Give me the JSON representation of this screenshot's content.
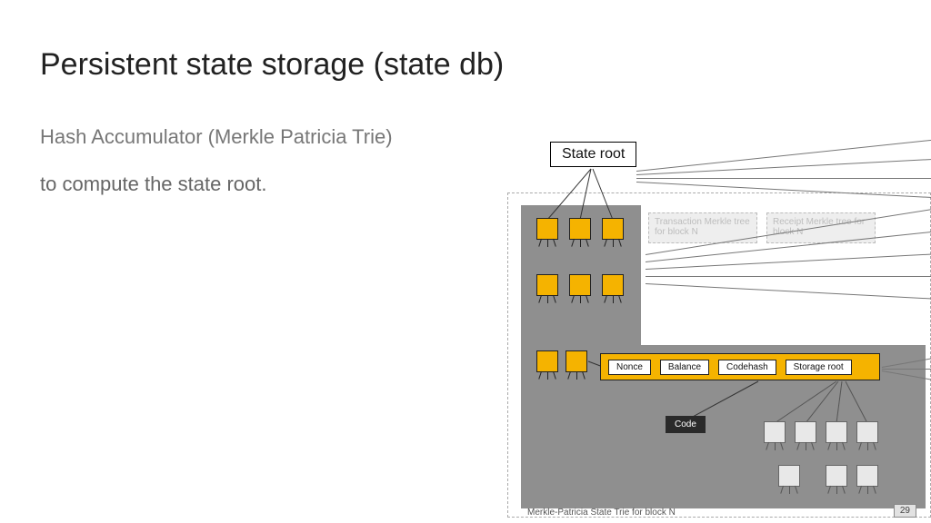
{
  "slide": {
    "title": "Persistent state storage (state db)",
    "subtitle1": "Hash Accumulator (Merkle Patricia Trie)",
    "subtitle2": "to compute the state root.",
    "page_number": "29"
  },
  "diagram": {
    "state_root_label": "State root",
    "faint_box_1": "Transaction Merkle tree for block N",
    "faint_box_2": "Receipt Merkle tree for block N",
    "account_fields": {
      "nonce": "Nonce",
      "balance": "Balance",
      "codehash": "Codehash",
      "storage_root": "Storage root"
    },
    "code_label": "Code",
    "caption": "Merkle-Patricia  State Trie  for block N"
  }
}
